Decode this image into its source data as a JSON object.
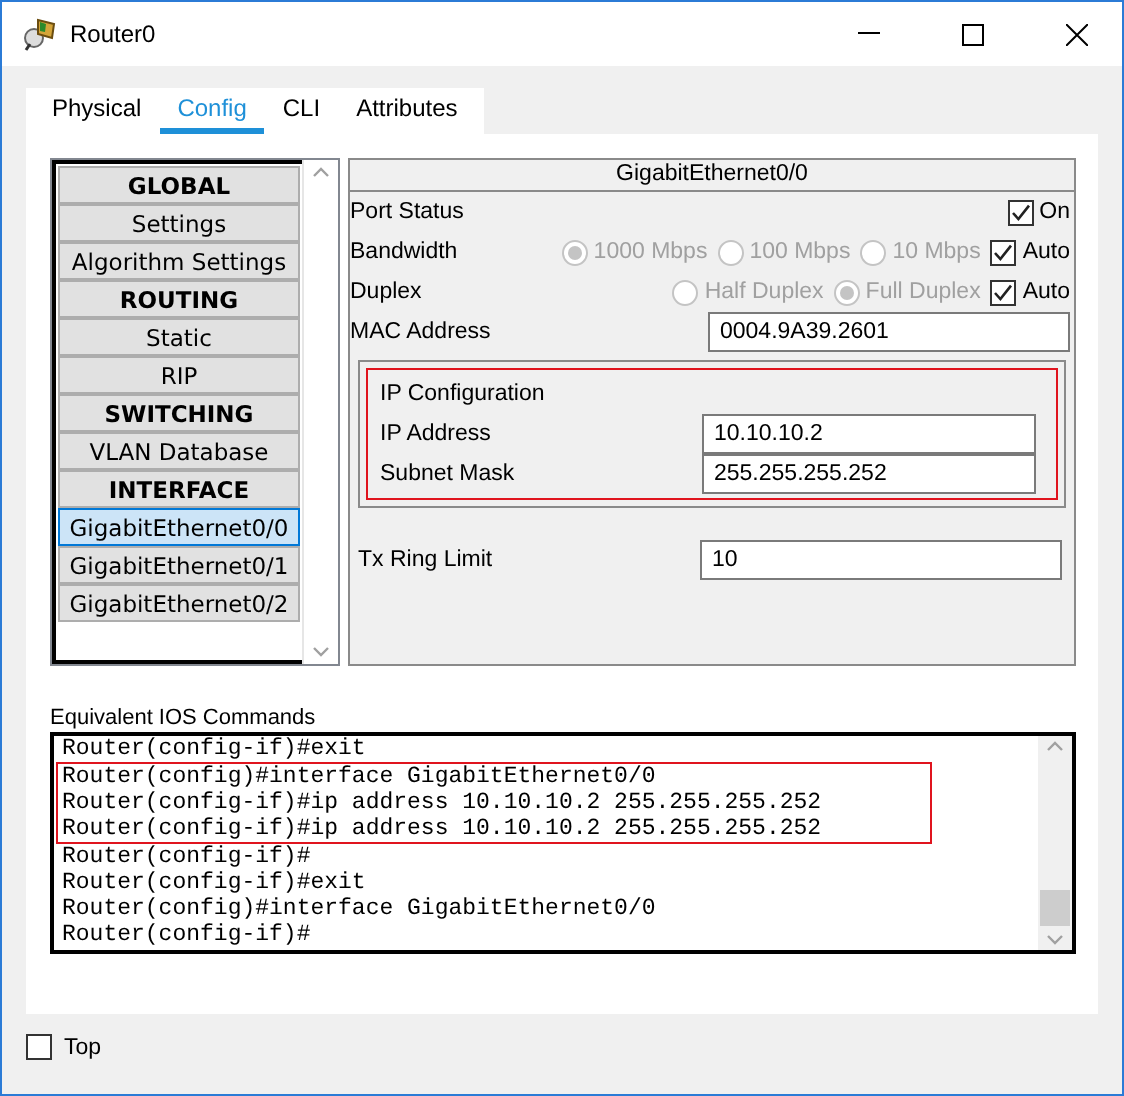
{
  "window": {
    "title": "Router0"
  },
  "tabs": [
    {
      "label": "Physical",
      "selected": false
    },
    {
      "label": "Config",
      "selected": true
    },
    {
      "label": "CLI",
      "selected": false
    },
    {
      "label": "Attributes",
      "selected": false
    }
  ],
  "sidebar": {
    "items": [
      {
        "label": "GLOBAL",
        "kind": "header",
        "selected": false
      },
      {
        "label": "Settings",
        "kind": "item",
        "selected": false
      },
      {
        "label": "Algorithm Settings",
        "kind": "item",
        "selected": false
      },
      {
        "label": "ROUTING",
        "kind": "header",
        "selected": false
      },
      {
        "label": "Static",
        "kind": "item",
        "selected": false
      },
      {
        "label": "RIP",
        "kind": "item",
        "selected": false
      },
      {
        "label": "SWITCHING",
        "kind": "header",
        "selected": false
      },
      {
        "label": "VLAN Database",
        "kind": "item",
        "selected": false
      },
      {
        "label": "INTERFACE",
        "kind": "header",
        "selected": false
      },
      {
        "label": "GigabitEthernet0/0",
        "kind": "item",
        "selected": true
      },
      {
        "label": "GigabitEthernet0/1",
        "kind": "item",
        "selected": false
      },
      {
        "label": "GigabitEthernet0/2",
        "kind": "item",
        "selected": false
      }
    ]
  },
  "interface": {
    "title": "GigabitEthernet0/0",
    "port_status": {
      "label": "Port Status",
      "checkbox": {
        "label": "On",
        "checked": true
      }
    },
    "bandwidth": {
      "label": "Bandwidth",
      "options": [
        {
          "label": "1000 Mbps",
          "selected": true,
          "disabled": true
        },
        {
          "label": "100 Mbps",
          "selected": false,
          "disabled": true
        },
        {
          "label": "10 Mbps",
          "selected": false,
          "disabled": true
        }
      ],
      "auto": {
        "label": "Auto",
        "checked": true
      }
    },
    "duplex": {
      "label": "Duplex",
      "options": [
        {
          "label": "Half Duplex",
          "selected": false,
          "disabled": true
        },
        {
          "label": "Full Duplex",
          "selected": true,
          "disabled": true
        }
      ],
      "auto": {
        "label": "Auto",
        "checked": true
      }
    },
    "mac_address": {
      "label": "MAC Address",
      "value": "0004.9A39.2601"
    },
    "ip_configuration": {
      "title": "IP Configuration",
      "highlighted": true,
      "ip_address": {
        "label": "IP Address",
        "value": "10.10.10.2"
      },
      "subnet_mask": {
        "label": "Subnet Mask",
        "value": "255.255.255.252"
      }
    },
    "tx_ring_limit": {
      "label": "Tx Ring Limit",
      "value": "10"
    }
  },
  "ios_commands": {
    "label": "Equivalent IOS Commands",
    "lines": [
      {
        "text": "Router(config-if)#exit",
        "highlighted": false
      },
      {
        "text": "Router(config)#interface GigabitEthernet0/0",
        "highlighted": true
      },
      {
        "text": "Router(config-if)#ip address 10.10.10.2 255.255.255.252",
        "highlighted": true
      },
      {
        "text": "Router(config-if)#ip address 10.10.10.2 255.255.255.252",
        "highlighted": true
      },
      {
        "text": "Router(config-if)#",
        "highlighted": false
      },
      {
        "text": "Router(config-if)#exit",
        "highlighted": false
      },
      {
        "text": "Router(config)#interface GigabitEthernet0/0",
        "highlighted": false
      },
      {
        "text": "Router(config-if)#",
        "highlighted": false
      }
    ]
  },
  "top_checkbox": {
    "label": "Top",
    "checked": false
  }
}
